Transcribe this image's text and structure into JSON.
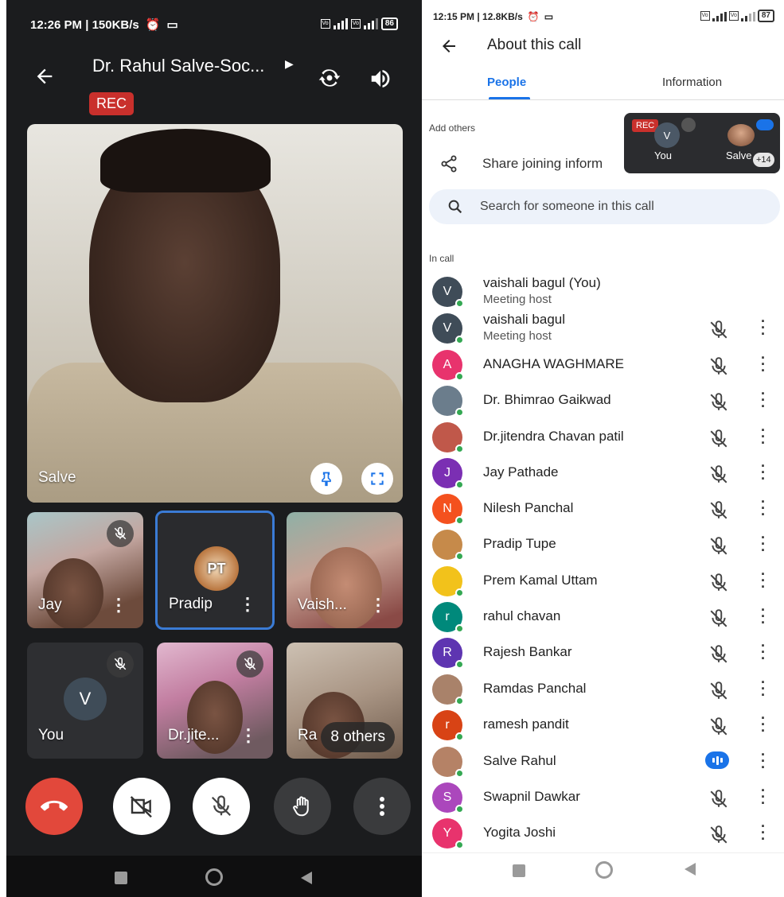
{
  "left": {
    "status": {
      "time": "12:26 PM | 150KB/s",
      "battery": "86"
    },
    "title": "Dr. Rahul Salve-Soc...",
    "rec": "REC",
    "main_tile": {
      "name": "Salve"
    },
    "tiles": [
      {
        "name": "Jay"
      },
      {
        "name": "Pradip"
      },
      {
        "name": "Vaish..."
      },
      {
        "name": "You",
        "initial": "V"
      },
      {
        "name": "Dr.jite..."
      },
      {
        "name": "Ra",
        "others": "8 others"
      }
    ],
    "pradip_avatar": "PT"
  },
  "right": {
    "status": {
      "time": "12:15 PM | 12.8KB/s",
      "battery": "87"
    },
    "title": "About this call",
    "tabs": [
      "People",
      "Information"
    ],
    "add_others": "Add others",
    "share": "Share joining inform",
    "search_placeholder": "Search for someone in this call",
    "in_call": "In call",
    "pip": {
      "rec": "REC",
      "you_initial": "V",
      "you": "You",
      "salve": "Salve",
      "plus": "+14"
    },
    "people": [
      {
        "name": "vaishali bagul (You)",
        "role": "Meeting host",
        "initial": "V",
        "color": "#3f4c58",
        "state": "none"
      },
      {
        "name": "vaishali bagul",
        "role": "Meeting host",
        "initial": "V",
        "color": "#3f4c58",
        "state": "muted"
      },
      {
        "name": "ANAGHA WAGHMARE",
        "role": "",
        "initial": "A",
        "color": "#e8336d",
        "state": "muted"
      },
      {
        "name": "Dr. Bhimrao Gaikwad",
        "role": "",
        "initial": "",
        "color": "#6b7d8c",
        "state": "muted"
      },
      {
        "name": "Dr.jitendra Chavan patil",
        "role": "",
        "initial": "",
        "color": "#c0584a",
        "state": "muted"
      },
      {
        "name": "Jay Pathade",
        "role": "",
        "initial": "J",
        "color": "#7b2fb3",
        "state": "muted"
      },
      {
        "name": "Nilesh Panchal",
        "role": "",
        "initial": "N",
        "color": "#f4511e",
        "state": "muted"
      },
      {
        "name": "Pradip Tupe",
        "role": "",
        "initial": "",
        "color": "#c68a4a",
        "state": "muted"
      },
      {
        "name": "Prem Kamal Uttam",
        "role": "",
        "initial": "",
        "color": "#f2c21b",
        "state": "muted"
      },
      {
        "name": "rahul chavan",
        "role": "",
        "initial": "r",
        "color": "#00897b",
        "state": "muted"
      },
      {
        "name": "Rajesh Bankar",
        "role": "",
        "initial": "R",
        "color": "#5e35b1",
        "state": "muted"
      },
      {
        "name": "Ramdas Panchal",
        "role": "",
        "initial": "",
        "color": "#a9826a",
        "state": "muted"
      },
      {
        "name": "ramesh pandit",
        "role": "",
        "initial": "r",
        "color": "#d84315",
        "state": "muted"
      },
      {
        "name": "Salve Rahul",
        "role": "",
        "initial": "",
        "color": "#b58266",
        "state": "speaking"
      },
      {
        "name": "Swapnil Dawkar",
        "role": "",
        "initial": "S",
        "color": "#ab47bc",
        "state": "muted"
      },
      {
        "name": "Yogita Joshi",
        "role": "",
        "initial": "Y",
        "color": "#e8336d",
        "state": "muted"
      }
    ]
  }
}
